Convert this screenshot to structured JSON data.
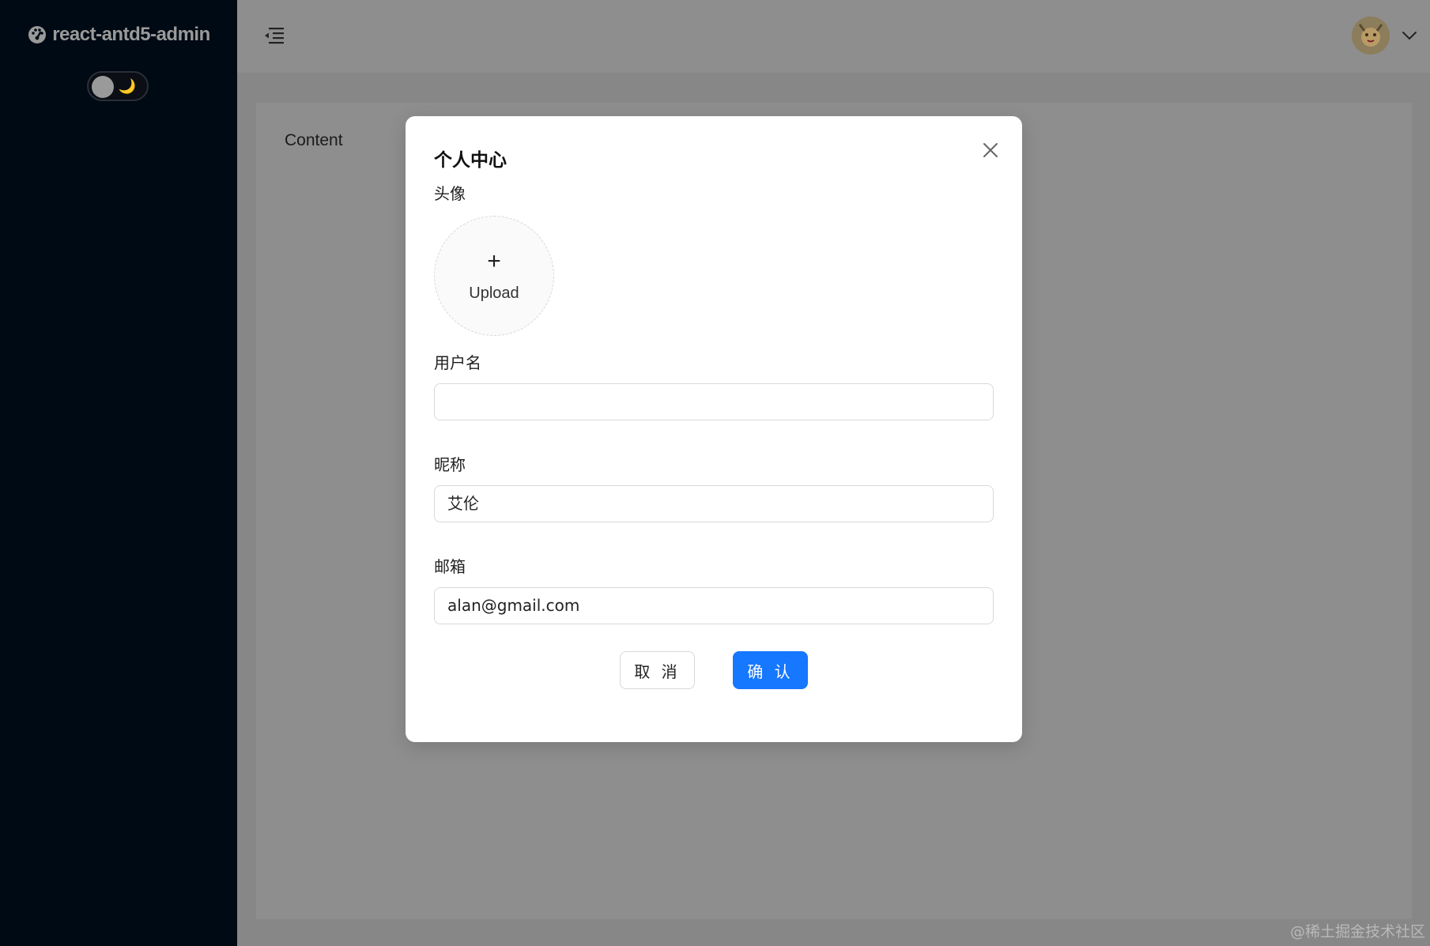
{
  "app": {
    "logo_text": "react-antd5-admin",
    "theme_toggle_icon": "moon-icon",
    "theme_toggle_moon_glyph": "🌙"
  },
  "header": {
    "menu_icon": "menu-fold-icon",
    "avatar_icon": "avatar",
    "caret_icon": "chevron-down-icon"
  },
  "content": {
    "text": "Content"
  },
  "modal": {
    "title": "个人中心",
    "avatar_label": "头像",
    "upload_plus": "+",
    "upload_text": "Upload",
    "username_label": "用户名",
    "username_value": "",
    "nickname_label": "昵称",
    "nickname_value": "艾伦",
    "email_label": "邮箱",
    "email_value": "alan@gmail.com",
    "cancel_label": "取 消",
    "ok_label": "确 认"
  },
  "watermark": "@稀土掘金技术社区",
  "colors": {
    "sidebar_bg": "#000a14",
    "primary": "#1677ff",
    "overlay_bg": "#8e8e8e"
  }
}
